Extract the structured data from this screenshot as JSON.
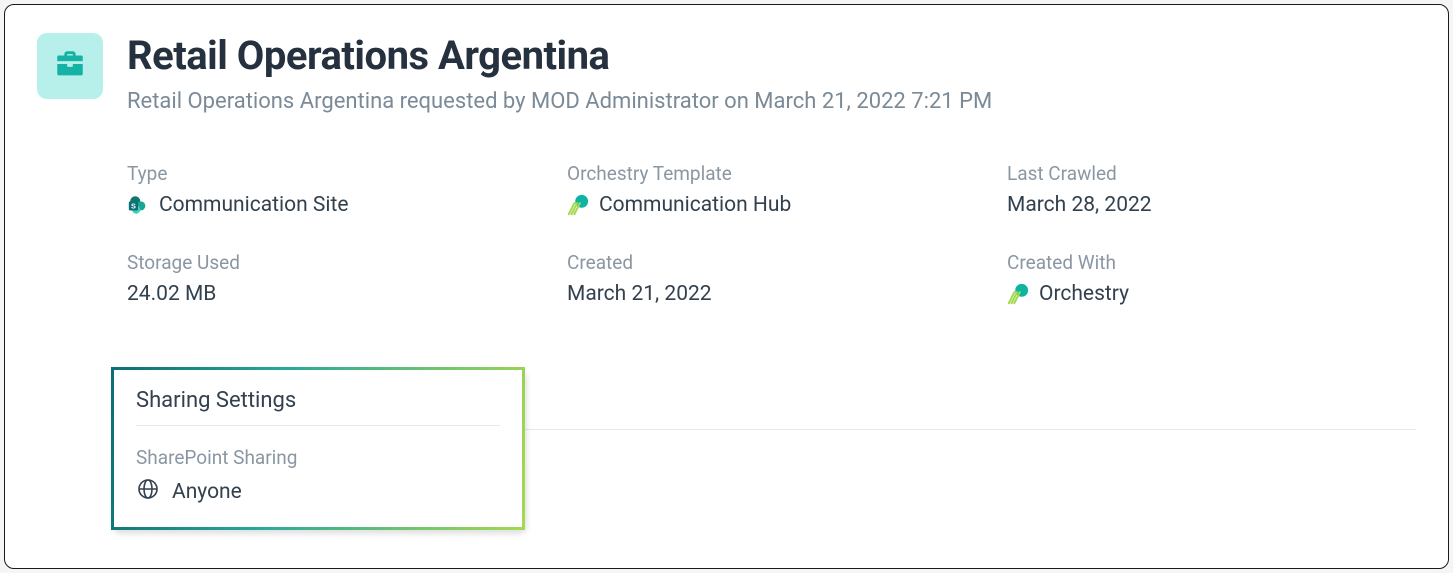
{
  "header": {
    "title": "Retail Operations Argentina",
    "subtitle": "Retail Operations Argentina requested by MOD Administrator on March 21, 2022 7:21 PM"
  },
  "details": {
    "type_label": "Type",
    "type_value": "Communication Site",
    "template_label": "Orchestry Template",
    "template_value": "Communication Hub",
    "crawled_label": "Last Crawled",
    "crawled_value": "March 28, 2022",
    "storage_label": "Storage Used",
    "storage_value": "24.02 MB",
    "created_label": "Created",
    "created_value": "March 21, 2022",
    "created_with_label": "Created With",
    "created_with_value": "Orchestry"
  },
  "sharing": {
    "panel_title": "Sharing Settings",
    "sp_label": "SharePoint Sharing",
    "sp_value": "Anyone"
  }
}
